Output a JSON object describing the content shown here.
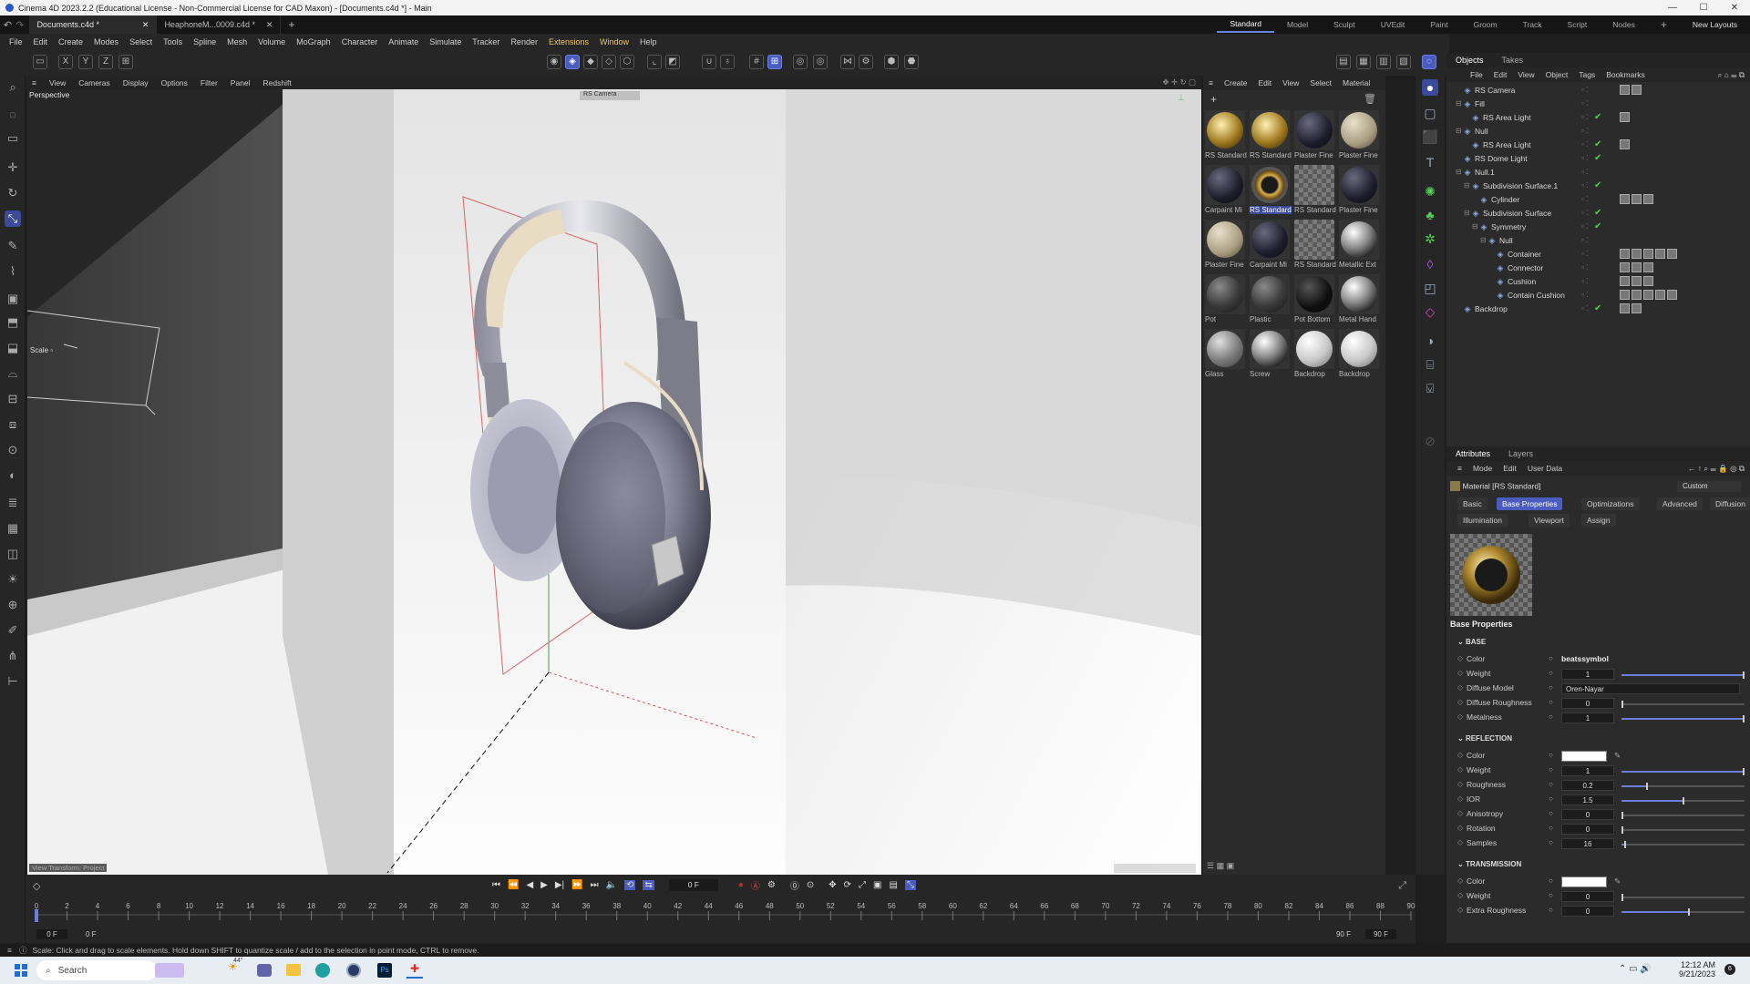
{
  "window": {
    "title": "Cinema 4D 2023.2.2 (Educational License - Non-Commercial License for CAD Maxon) - [Documents.c4d *] - Main",
    "controls": [
      "—",
      "☐",
      "✕"
    ]
  },
  "tabs": {
    "docs": [
      "Documents.c4d *",
      "HeaphoneM...0009.c4d *"
    ],
    "layouts": [
      "Standard",
      "Model",
      "Sculpt",
      "UVEdit",
      "Paint",
      "Groom",
      "Track",
      "Script",
      "Nodes"
    ],
    "new_layouts": "New Layouts"
  },
  "menu": [
    "File",
    "Edit",
    "Create",
    "Modes",
    "Select",
    "Tools",
    "Spline",
    "Mesh",
    "Volume",
    "MoGraph",
    "Character",
    "Animate",
    "Simulate",
    "Tracker",
    "Render",
    "Extensions",
    "Window",
    "Help"
  ],
  "viewport": {
    "menu": [
      "View",
      "Cameras",
      "Display",
      "Options",
      "Filter",
      "Panel",
      "Redshift"
    ],
    "label": "Perspective",
    "camera_label": "RS Camera",
    "scale_label": "Scale",
    "transform_label": "View Transform: Project"
  },
  "materials": {
    "menu": [
      "Create",
      "Edit",
      "View",
      "Select",
      "Material"
    ],
    "items": [
      {
        "name": "RS Standard",
        "swatch": "gold"
      },
      {
        "name": "RS Standard",
        "swatch": "gold"
      },
      {
        "name": "Plaster Fine",
        "swatch": "dark"
      },
      {
        "name": "Plaster Fine",
        "swatch": "beige"
      },
      {
        "name": "Carpaint Mi",
        "swatch": "dark"
      },
      {
        "name": "RS Standard",
        "swatch": "goldring"
      },
      {
        "name": "RS Standard",
        "swatch": "checker"
      },
      {
        "name": "Plaster Fine",
        "swatch": "dark"
      },
      {
        "name": "Plaster Fine",
        "swatch": "beige"
      },
      {
        "name": "Carpaint Mi",
        "swatch": "dark"
      },
      {
        "name": "RS Standard",
        "swatch": "checker"
      },
      {
        "name": "Metallic Ext",
        "swatch": "chrome"
      },
      {
        "name": "Pot",
        "swatch": "darkgray"
      },
      {
        "name": "Plastic",
        "swatch": "darkgray"
      },
      {
        "name": "Pot Bottom",
        "swatch": "black"
      },
      {
        "name": "Metal Hand",
        "swatch": "chrome"
      },
      {
        "name": "Glass",
        "swatch": "glass"
      },
      {
        "name": "Screw",
        "swatch": "chrome"
      },
      {
        "name": "Backdrop",
        "swatch": "white"
      },
      {
        "name": "Backdrop",
        "swatch": "white"
      }
    ],
    "selected_index": 5
  },
  "objects": {
    "tabs": [
      "Objects",
      "Takes"
    ],
    "menu": [
      "File",
      "Edit",
      "View",
      "Object",
      "Tags",
      "Bookmarks"
    ],
    "tree": [
      {
        "name": "RS Camera",
        "indent": 0,
        "check": false,
        "tags": 2
      },
      {
        "name": "Fill",
        "indent": 0,
        "check": false,
        "tags": 0
      },
      {
        "name": "RS Area Light",
        "indent": 1,
        "check": true,
        "tags": 1
      },
      {
        "name": "Null",
        "indent": 0,
        "check": false,
        "tags": 0
      },
      {
        "name": "RS Area Light",
        "indent": 1,
        "check": true,
        "tags": 1
      },
      {
        "name": "RS Dome Light",
        "indent": 0,
        "check": true,
        "tags": 0
      },
      {
        "name": "Null.1",
        "indent": 0,
        "check": false,
        "tags": 0
      },
      {
        "name": "Subdivision Surface.1",
        "indent": 1,
        "check": true,
        "tags": 0
      },
      {
        "name": "Cylinder",
        "indent": 2,
        "check": false,
        "tags": 3
      },
      {
        "name": "Subdivision Surface",
        "indent": 1,
        "check": true,
        "tags": 0
      },
      {
        "name": "Symmetry",
        "indent": 2,
        "check": true,
        "tags": 0
      },
      {
        "name": "Null",
        "indent": 3,
        "check": false,
        "tags": 0
      },
      {
        "name": "Container",
        "indent": 4,
        "check": false,
        "tags": 5
      },
      {
        "name": "Connector",
        "indent": 4,
        "check": false,
        "tags": 3
      },
      {
        "name": "Cushion",
        "indent": 4,
        "check": false,
        "tags": 3
      },
      {
        "name": "Contain Cushion",
        "indent": 4,
        "check": false,
        "tags": 5
      },
      {
        "name": "Backdrop",
        "indent": 0,
        "check": true,
        "tags": 2
      }
    ]
  },
  "attributes": {
    "tabs": [
      "Attributes",
      "Layers"
    ],
    "menu": [
      "Mode",
      "Edit",
      "User Data"
    ],
    "material_title": "Material [RS Standard]",
    "preset": "Custom",
    "subtabs": [
      "Basic",
      "Base Properties",
      "Optimizations",
      "Advanced",
      "Diffusion",
      "Illumination",
      "Viewport",
      "Assign"
    ],
    "selected_subtab": "Base Properties",
    "heading": "Base Properties",
    "sections": {
      "base": "BASE",
      "reflection": "REFLECTION",
      "transmission": "TRANSMISSION"
    },
    "base_rows": [
      {
        "label": "Color",
        "value": "beatssymbol",
        "slider": null
      },
      {
        "label": "Weight",
        "value": "1",
        "slider": 1.0
      },
      {
        "label": "Diffuse Model",
        "value": "Oren-Nayar",
        "slider": null
      },
      {
        "label": "Diffuse Roughness",
        "value": "0",
        "slider": 0.0
      },
      {
        "label": "Metalness",
        "value": "1",
        "slider": 1.0
      }
    ],
    "reflection_rows": [
      {
        "label": "Color",
        "value": "",
        "slider": null
      },
      {
        "label": "Weight",
        "value": "1",
        "slider": 1.0
      },
      {
        "label": "Roughness",
        "value": "0.2",
        "slider": 0.2
      },
      {
        "label": "IOR",
        "value": "1.5",
        "slider": 0.5
      },
      {
        "label": "Anisotropy",
        "value": "0",
        "slider": 0.0
      },
      {
        "label": "Rotation",
        "value": "0",
        "slider": 0.0
      },
      {
        "label": "Samples",
        "value": "16",
        "slider": 0.02
      }
    ],
    "transmission_rows": [
      {
        "label": "Color",
        "value": "",
        "slider": null
      },
      {
        "label": "Weight",
        "value": "0",
        "slider": 0.0
      },
      {
        "label": "Extra Roughness",
        "value": "0",
        "slider": 0.55
      }
    ]
  },
  "timeline": {
    "current_frame": "0 F",
    "start": "0 F",
    "end_a": "90 F",
    "end_b": "90 F",
    "ticks": [
      "0",
      "2",
      "4",
      "6",
      "8",
      "10",
      "12",
      "14",
      "16",
      "18",
      "20",
      "22",
      "24",
      "26",
      "28",
      "30",
      "32",
      "34",
      "36",
      "38",
      "40",
      "42",
      "44",
      "46",
      "48",
      "50",
      "52",
      "54",
      "56",
      "58",
      "60",
      "62",
      "64",
      "66",
      "68",
      "70",
      "72",
      "74",
      "76",
      "78",
      "80",
      "82",
      "84",
      "86",
      "88",
      "90"
    ]
  },
  "status": "Scale: Click and drag to scale elements. Hold down SHIFT to quantize scale / add to the selection in point mode, CTRL to remove.",
  "taskbar": {
    "search": "Search",
    "weather": "44°",
    "time": "12:12 AM",
    "date": "9/21/2023"
  },
  "colors": {
    "accent": "#4a5cc0",
    "highlight_menu": "#f0c860",
    "check": "#55cc55"
  }
}
